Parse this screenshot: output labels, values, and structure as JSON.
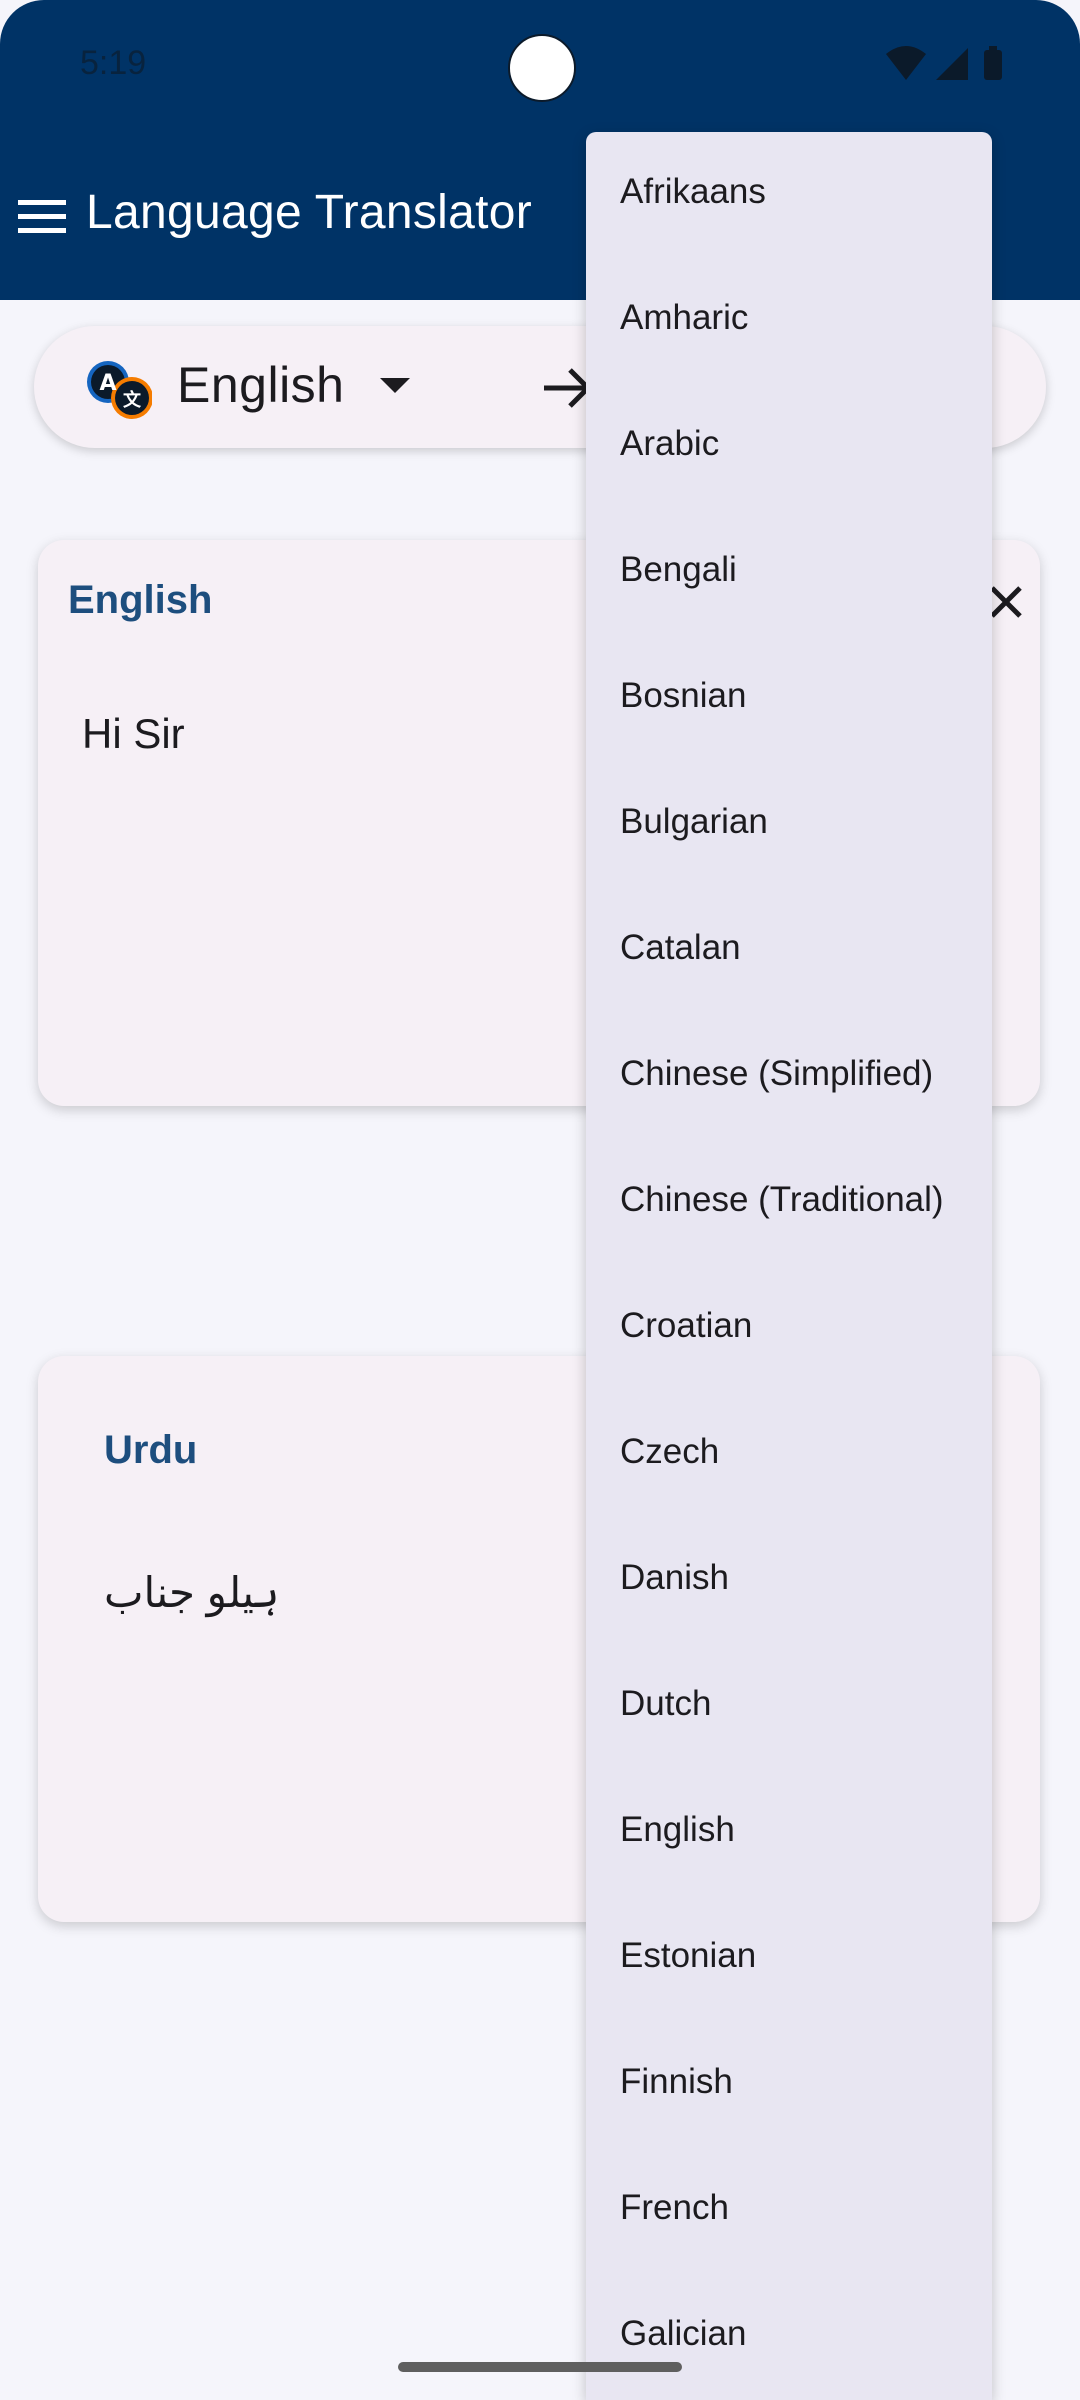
{
  "status_bar": {
    "time": "5:19"
  },
  "app_bar": {
    "title": "Language Translator"
  },
  "language_selector": {
    "source_language": "English"
  },
  "source_card": {
    "label": "English",
    "text": "Hi Sir"
  },
  "target_card": {
    "label": "Urdu",
    "text": "ہیلو جناب"
  },
  "dropdown": {
    "items": [
      "Afrikaans",
      "Amharic",
      "Arabic",
      "Bengali",
      "Bosnian",
      "Bulgarian",
      "Catalan",
      "Chinese (Simplified)",
      "Chinese (Traditional)",
      "Croatian",
      "Czech",
      "Danish",
      "Dutch",
      "English",
      "Estonian",
      "Finnish",
      "French",
      "Galician"
    ]
  },
  "colors": {
    "app_bar": "#003366",
    "card_label": "#1d4e7e",
    "dropdown_background": "#e8e6f2",
    "page_background": "#f5f5fb"
  }
}
